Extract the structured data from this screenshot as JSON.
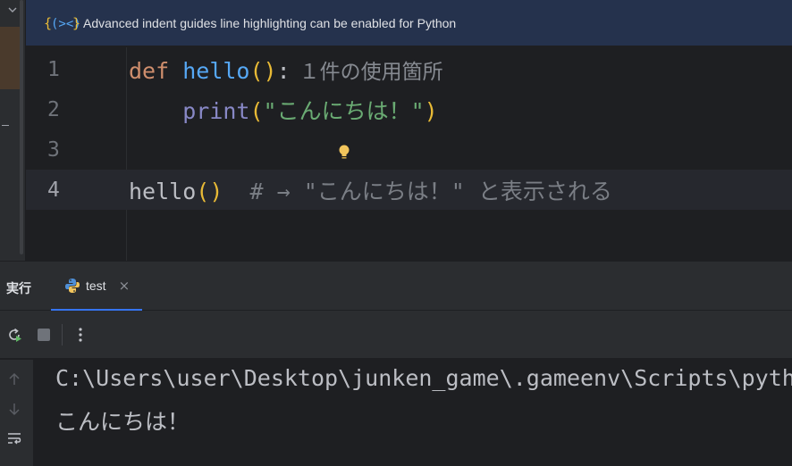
{
  "banner": {
    "text": "Advanced indent guides line highlighting can be enabled for Python",
    "icon": "indent-guides-icon"
  },
  "editor": {
    "lines": [
      {
        "number": "1",
        "def": "def",
        "name": "hello",
        "open": "(",
        "close": ")",
        "colon": ":",
        "hint": "１件の使用箇所"
      },
      {
        "number": "2",
        "indent": "    ",
        "print": "print",
        "open": "(",
        "string": "\"こんにちは！\"",
        "close": ")"
      },
      {
        "number": "3"
      },
      {
        "number": "4",
        "call": "hello",
        "open": "(",
        "close": ")",
        "comment": "  # → \"こんにちは！\" と表示される"
      }
    ]
  },
  "run_panel": {
    "title": "実行",
    "tab": {
      "label": "test",
      "close": "×",
      "icon": "python-icon"
    },
    "toolbar": {
      "rerun_icon": "rerun-icon",
      "stop_icon": "stop-icon",
      "more_icon": "more-vertical-icon"
    }
  },
  "console": {
    "lines": [
      "C:\\Users\\user\\Desktop\\junken_game\\.gameenv\\Scripts\\python.exe",
      "こんにちは！"
    ]
  },
  "colors": {
    "keyword": "#cf8e6d",
    "function": "#56a8f5",
    "builtin": "#8888c6",
    "string": "#6aab73",
    "paren": "#e8ba36",
    "comment": "#7a7e85",
    "accent": "#3574f0"
  }
}
